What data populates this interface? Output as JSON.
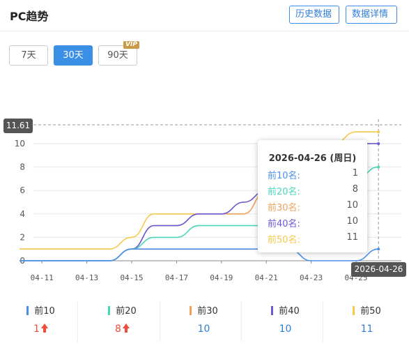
{
  "header": {
    "title": "PC趋势",
    "history_label": "历史数据",
    "detail_label": "数据详情"
  },
  "range_tabs": {
    "d7": "7天",
    "d30": "30天",
    "d90": "90天",
    "vip_badge": "VIP",
    "selected": "30天"
  },
  "axis_pointer": {
    "y_value": "11.61",
    "x_value": "2026-04-26"
  },
  "tooltip": {
    "date": "2026-04-26 (周日)",
    "rows": [
      {
        "label": "前10名:",
        "value": "1"
      },
      {
        "label": "前20名:",
        "value": "8"
      },
      {
        "label": "前30名:",
        "value": "10"
      },
      {
        "label": "前40名:",
        "value": "10"
      },
      {
        "label": "前50名:",
        "value": "11"
      }
    ]
  },
  "legend": [
    {
      "name": "前10",
      "value": "1",
      "trend": "up"
    },
    {
      "name": "前20",
      "value": "8",
      "trend": "up"
    },
    {
      "name": "前30",
      "value": "10",
      "trend": ""
    },
    {
      "name": "前40",
      "value": "10",
      "trend": ""
    },
    {
      "name": "前50",
      "value": "11",
      "trend": ""
    }
  ],
  "colors": {
    "accent": "#3b8fe6",
    "up": "#f04c3c",
    "top10": "#4b8fe8",
    "top20": "#4ad6b8",
    "top30": "#f0a25a",
    "top40": "#6a5adb",
    "top50": "#f7c94a"
  },
  "chart_data": {
    "type": "line",
    "x": [
      "04-10",
      "04-11",
      "04-12",
      "04-13",
      "04-14",
      "04-15",
      "04-16",
      "04-17",
      "04-18",
      "04-19",
      "04-20",
      "04-21",
      "04-22",
      "04-23",
      "04-24",
      "04-25",
      "04-26"
    ],
    "x_tick_labels": [
      "04-11",
      "04-13",
      "04-15",
      "04-17",
      "04-19",
      "04-21",
      "04-23",
      "04-25"
    ],
    "y_ticks": [
      0,
      2,
      4,
      6,
      8,
      10
    ],
    "ylim": [
      0,
      12
    ],
    "grid": true,
    "series": [
      {
        "name": "前10",
        "color": "#4b8fe8",
        "values": [
          0,
          0,
          0,
          0,
          0,
          1,
          1,
          1,
          1,
          1,
          1,
          1,
          1,
          0,
          0,
          0,
          1
        ]
      },
      {
        "name": "前20",
        "color": "#4ad6b8",
        "values": [
          0,
          0,
          0,
          0,
          0,
          1,
          2,
          2,
          3,
          3,
          3,
          3,
          5,
          5,
          6,
          7,
          8
        ]
      },
      {
        "name": "前30",
        "color": "#f0a25a",
        "values": [
          0,
          0,
          0,
          0,
          0,
          1,
          3,
          3,
          4,
          4,
          4,
          6,
          7,
          8,
          9,
          10,
          10
        ]
      },
      {
        "name": "前40",
        "color": "#6a5adb",
        "values": [
          0,
          0,
          0,
          0,
          0,
          1,
          3,
          3,
          4,
          4,
          5,
          6,
          7,
          8,
          9,
          10,
          10
        ]
      },
      {
        "name": "前50",
        "color": "#f7c94a",
        "values": [
          1,
          1,
          1,
          1,
          1,
          2,
          4,
          4,
          4,
          4,
          5,
          6,
          7,
          8,
          10,
          11,
          11
        ]
      }
    ]
  }
}
